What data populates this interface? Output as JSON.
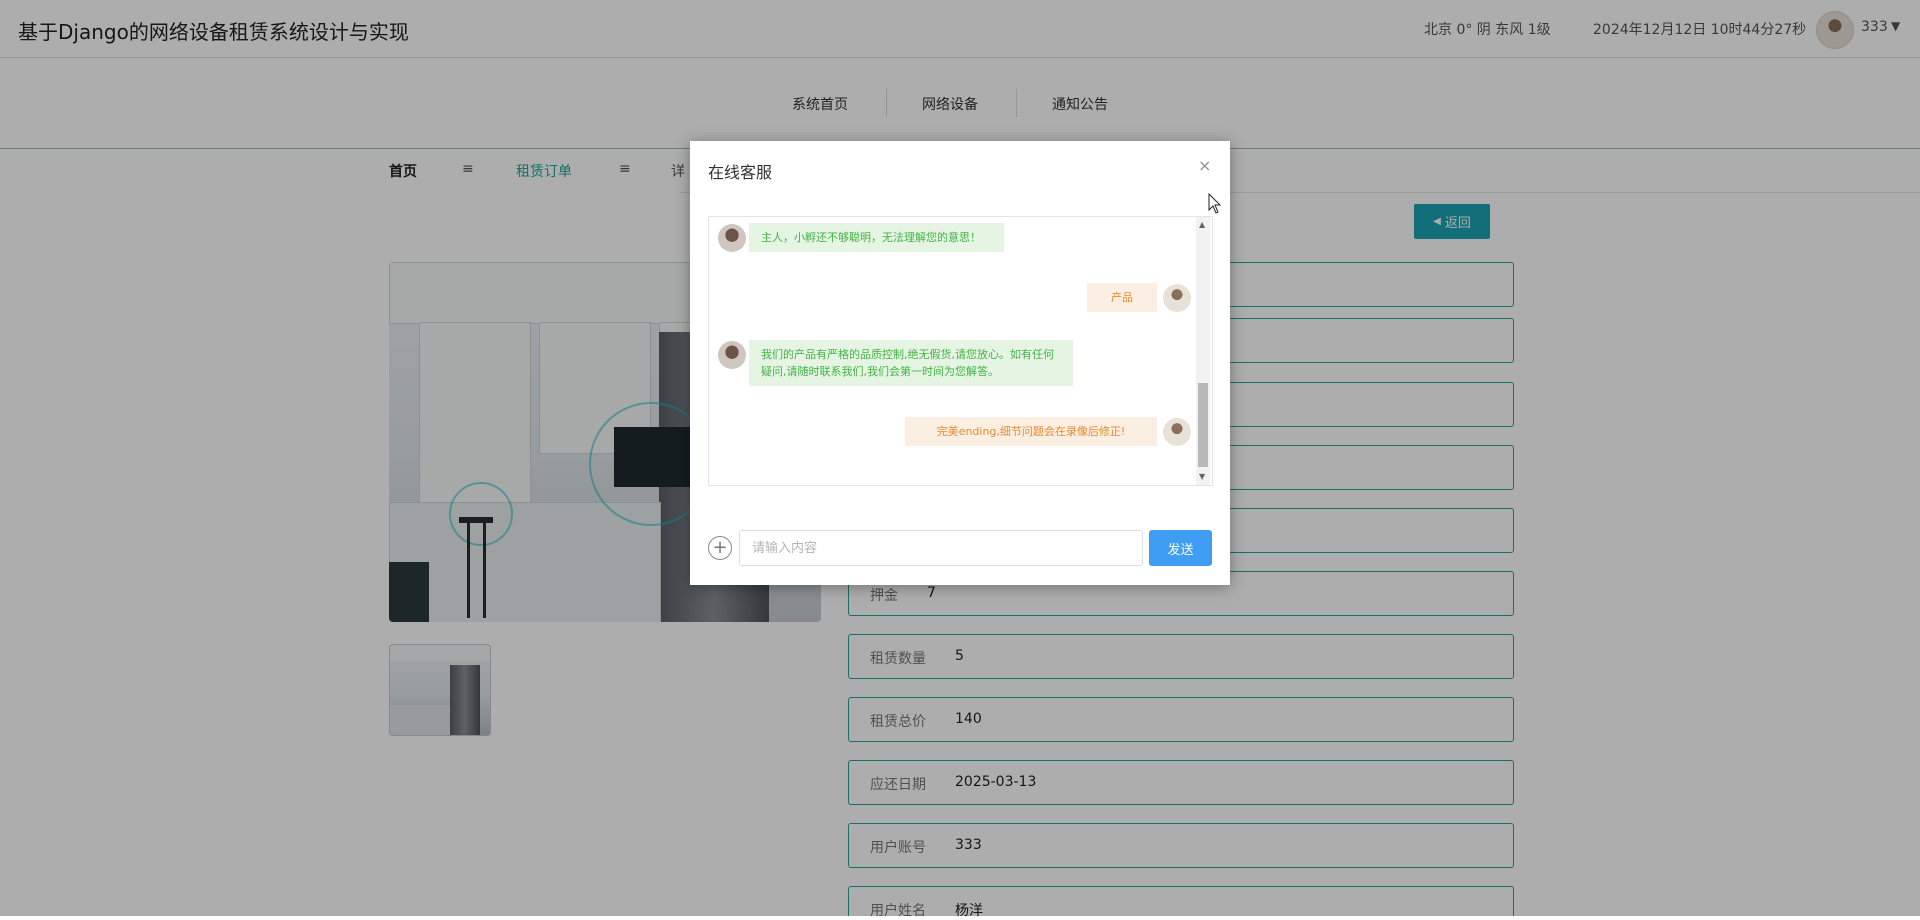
{
  "header": {
    "app_title": "基于Django的网络设备租赁系统设计与实现",
    "weather": "北京 0° 阴 东风 1级",
    "datetime": "2024年12月12日 10时44分27秒",
    "username": "333",
    "caret": "▼"
  },
  "nav": {
    "items": [
      {
        "label": "系统首页"
      },
      {
        "label": "网络设备"
      },
      {
        "label": "通知公告"
      }
    ]
  },
  "breadcrumb": {
    "home": "首页",
    "sep": "≡",
    "orders": "租赁订单",
    "detail": "详"
  },
  "back_button": "返回",
  "fields": [
    {
      "label": "押金",
      "value": "7"
    },
    {
      "label": "租赁数量",
      "value": "5"
    },
    {
      "label": "租赁总价",
      "value": "140"
    },
    {
      "label": "应还日期",
      "value": "2025-03-13"
    },
    {
      "label": "用户账号",
      "value": "333"
    },
    {
      "label": "用户姓名",
      "value": "杨洋"
    }
  ],
  "dialog": {
    "title": "在线客服",
    "close": "×",
    "messages": [
      {
        "from": "bot",
        "text": "主人，小孵还不够聪明，无法理解您的意思！"
      },
      {
        "from": "me",
        "text": "产品"
      },
      {
        "from": "bot",
        "text": "我们的产品有严格的品质控制,绝无假货,请您放心。如有任何疑问,请随时联系我们,我们会第一时间为您解答。"
      },
      {
        "from": "me",
        "text": "完美ending,细节问题会在录像后修正!"
      }
    ],
    "input_placeholder": "请输入内容",
    "add": "+",
    "send": "发送"
  },
  "colors": {
    "accent": "#20a595",
    "back_button": "#1ba3b2",
    "send_button": "#3f9ef4",
    "bot_bubble": "#e6f5e3",
    "user_bubble": "#fbeee3"
  }
}
